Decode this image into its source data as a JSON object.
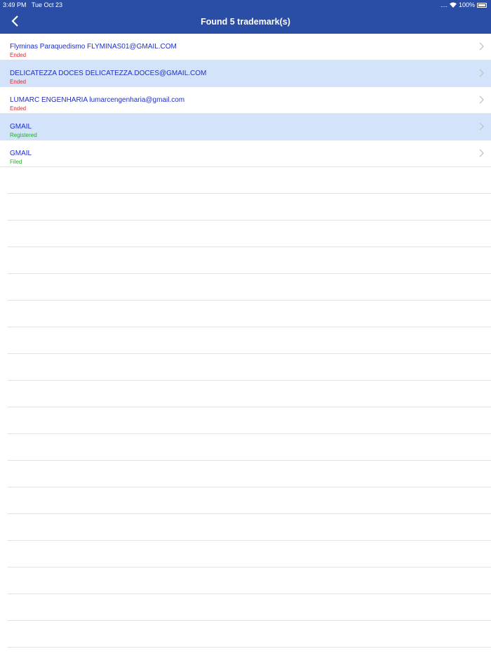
{
  "status_bar": {
    "time": "3:49 PM",
    "date": "Tue Oct 23",
    "signal": "....",
    "battery": "100%"
  },
  "header": {
    "title": "Found 5 trademark(s)"
  },
  "items": [
    {
      "name": "Flyminas Paraquedismo FLYMINAS01@GMAIL.COM",
      "status": "Ended",
      "status_color": "#e8262b"
    },
    {
      "name": "DELICATEZZA DOCES DELICATEZZA.DOCES@GMAIL.COM",
      "status": "Ended",
      "status_color": "#e8262b"
    },
    {
      "name": "LUMARC ENGENHARIA lumarcengenharia@gmail.com",
      "status": "Ended",
      "status_color": "#e8262b"
    },
    {
      "name": "GMAIL",
      "status": "Registered",
      "status_color": "#1fb01f"
    },
    {
      "name": "GMAIL",
      "status": "Filed",
      "status_color": "#1fb01f"
    }
  ]
}
